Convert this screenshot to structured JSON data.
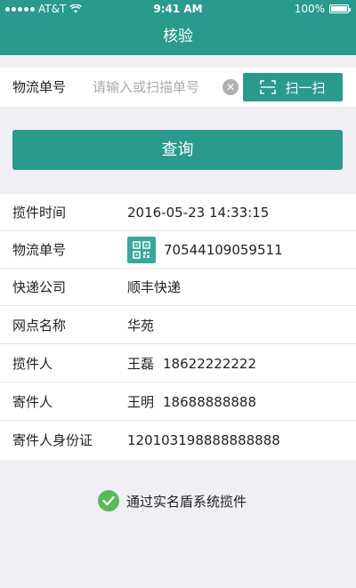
{
  "status_bar": {
    "carrier": "AT&T",
    "time": "9:41 AM",
    "battery": "100%"
  },
  "nav": {
    "title": "核验"
  },
  "search": {
    "label": "物流单号",
    "placeholder": "请输入或扫描单号",
    "value": "",
    "scan_label": "扫一扫"
  },
  "query_button": {
    "label": "查询"
  },
  "details": {
    "pickup_time": {
      "label": "揽件时间",
      "value": "2016-05-23 14:33:15"
    },
    "tracking_number": {
      "label": "物流单号",
      "value": "70544109059511"
    },
    "courier": {
      "label": "快递公司",
      "value": "顺丰快递"
    },
    "outlet": {
      "label": "网点名称",
      "value": "华苑"
    },
    "collector": {
      "label": "揽件人",
      "name": "王磊",
      "phone": "18622222222"
    },
    "sender": {
      "label": "寄件人",
      "name": "王明",
      "phone": "18688888888"
    },
    "sender_id": {
      "label": "寄件人身份证",
      "value": "120103198888888888"
    }
  },
  "verification": {
    "text": "通过实名盾系统揽件",
    "color": "#5cb85c"
  },
  "colors": {
    "primary": "#2a9a8c",
    "background": "#efeff4"
  }
}
